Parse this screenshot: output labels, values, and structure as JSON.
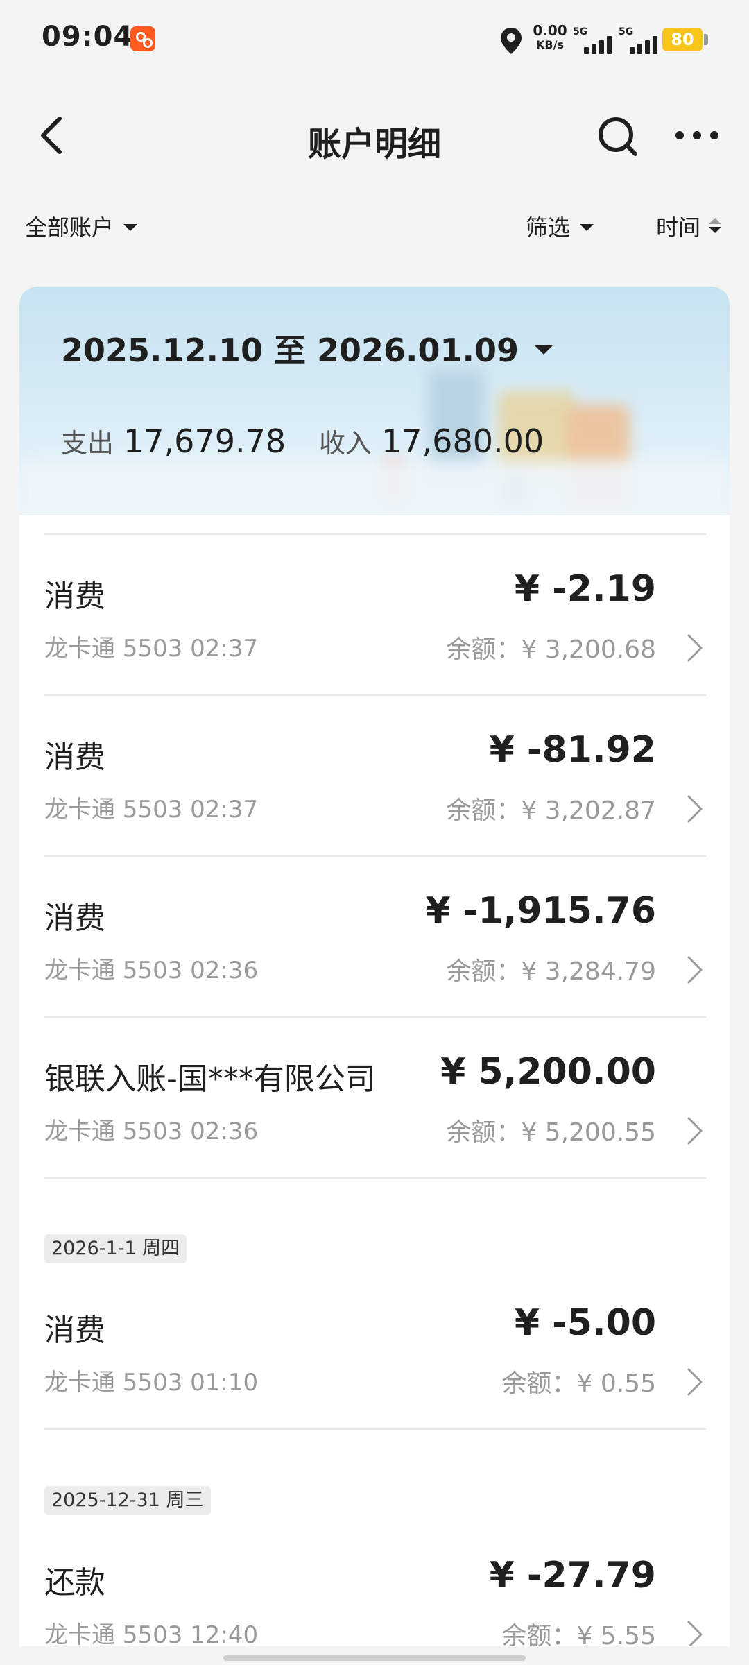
{
  "status_bar": {
    "time": "09:04",
    "network_speed_value": "0.00",
    "network_speed_unit": "KB/s",
    "signal1_label": "5G",
    "signal2_label": "5G",
    "battery": "80",
    "icons": [
      "app-badge-icon",
      "location-icon",
      "signal-icon",
      "battery-icon"
    ]
  },
  "header": {
    "title": "账户明细",
    "icons": [
      "back-icon",
      "search-icon",
      "more-icon"
    ]
  },
  "filters": {
    "account": "全部账户",
    "filter": "筛选",
    "sort": "时间"
  },
  "summary": {
    "date_range": "2025.12.10 至 2026.01.09",
    "expense_label": "支出",
    "expense_value": "17,679.78",
    "income_label": "收入",
    "income_value": "17,680.00"
  },
  "transactions": [
    {
      "title": "消费",
      "amount": "¥ -2.19",
      "sub": "龙卡通 5503 02:37",
      "balance": "余额：¥ 3,200.68"
    },
    {
      "title": "消费",
      "amount": "¥ -81.92",
      "sub": "龙卡通 5503 02:37",
      "balance": "余额：¥ 3,202.87"
    },
    {
      "title": "消费",
      "amount": "¥ -1,915.76",
      "sub": "龙卡通 5503 02:36",
      "balance": "余额：¥ 3,284.79"
    },
    {
      "title": "银联入账-国***有限公司",
      "amount": "¥ 5,200.00",
      "sub": "龙卡通 5503 02:36",
      "balance": "余额：¥ 5,200.55"
    },
    {
      "title": "消费",
      "amount": "¥ -5.00",
      "sub": "龙卡通 5503 01:10",
      "balance": "余额：¥ 0.55"
    },
    {
      "title": "还款",
      "amount": "¥ -27.79",
      "sub": "龙卡通 5503 12:40",
      "balance": "余额：¥ 5.55"
    }
  ],
  "date_groups": [
    "2026-1-1 周四",
    "2025-12-31 周三"
  ],
  "colors": {
    "background": "#f4f4f4",
    "card": "#ffffff",
    "text": "#1f1f1f",
    "secondary_text": "#9a9a9a",
    "battery": "#f7c41a",
    "app_badge": "#ff5a1f",
    "summary_bg": "#c7e3f1"
  }
}
